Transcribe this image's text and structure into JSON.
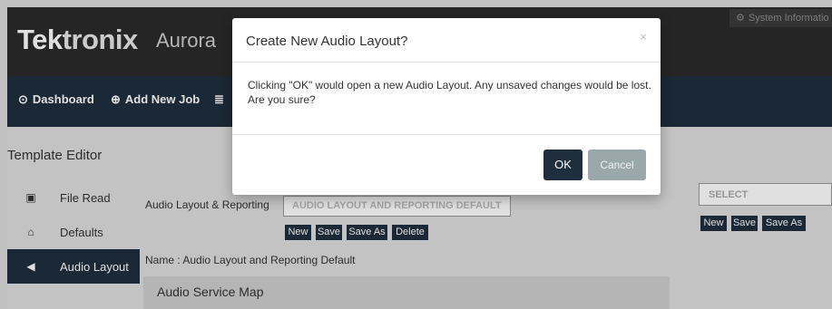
{
  "header": {
    "logo_main": "Tek",
    "logo_accent": "tronix",
    "app_name": "Aurora",
    "system_info": "System Informatio"
  },
  "nav": {
    "items": [
      {
        "label": "Dashboard",
        "icon": "clock-icon"
      },
      {
        "label": "Add New Job",
        "icon": "plus-circle-icon"
      },
      {
        "label": "",
        "icon": "list-icon"
      }
    ]
  },
  "sidebar": {
    "title": "Template Editor",
    "items": [
      {
        "label": "File Read",
        "icon": "file-icon",
        "active": false
      },
      {
        "label": "Defaults",
        "icon": "home-icon",
        "active": false
      },
      {
        "label": "Audio Layout",
        "icon": "megaphone-icon",
        "active": true
      }
    ]
  },
  "main": {
    "layout_label": "Audio Layout & Reporting",
    "layout_select_value": "AUDIO LAYOUT AND REPORTING DEFAULT",
    "buttons": [
      "New",
      "Save",
      "Save As",
      "Delete"
    ],
    "name_line": "Name : Audio Layout and Reporting Default",
    "service_map_title": "Audio Service Map"
  },
  "right_panel": {
    "select_value": "SELECT",
    "buttons": [
      "New",
      "Save",
      "Save As"
    ]
  },
  "modal": {
    "title": "Create New Audio Layout?",
    "close": "×",
    "body": "Clicking \"OK\" would open a new Audio Layout. Any unsaved changes would be lost. Are you sure?",
    "ok_label": "OK",
    "cancel_label": "Cancel"
  },
  "colors": {
    "header_bg": "#2b2b2b",
    "nav_bg": "#1f2e3d",
    "content_bg": "#dedede",
    "cancel_bg": "#9aa7ab"
  }
}
